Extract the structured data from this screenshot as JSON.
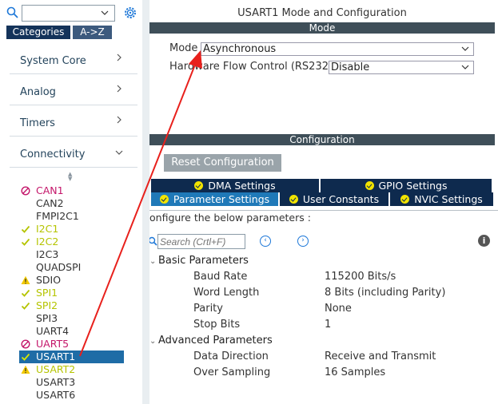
{
  "left": {
    "search": {
      "value": ""
    },
    "tabs": {
      "categories": "Categories",
      "az": "A->Z"
    },
    "categories": [
      {
        "label": "System Core"
      },
      {
        "label": "Analog"
      },
      {
        "label": "Timers"
      },
      {
        "label": "Connectivity"
      }
    ],
    "peripherals": [
      {
        "name": "CAN1",
        "status": "disabled"
      },
      {
        "name": "CAN2",
        "status": "none"
      },
      {
        "name": "FMPI2C1",
        "status": "none"
      },
      {
        "name": "I2C1",
        "status": "ok"
      },
      {
        "name": "I2C2",
        "status": "ok"
      },
      {
        "name": "I2C3",
        "status": "none"
      },
      {
        "name": "QUADSPI",
        "status": "none"
      },
      {
        "name": "SDIO",
        "status": "warning"
      },
      {
        "name": "SPI1",
        "status": "ok"
      },
      {
        "name": "SPI2",
        "status": "ok"
      },
      {
        "name": "SPI3",
        "status": "none"
      },
      {
        "name": "UART4",
        "status": "none"
      },
      {
        "name": "UART5",
        "status": "disabled"
      },
      {
        "name": "USART1",
        "status": "ok-selected"
      },
      {
        "name": "USART2",
        "status": "warning"
      },
      {
        "name": "USART3",
        "status": "none"
      },
      {
        "name": "USART6",
        "status": "none"
      }
    ]
  },
  "right": {
    "title": "USART1 Mode and Configuration",
    "mode_bar": "Mode",
    "mode_label": "Mode",
    "mode_value": "Asynchronous",
    "flow_label": "Hardware Flow Control (RS232)",
    "flow_value": "Disable",
    "config_bar": "Configuration",
    "reset_label": "Reset Configuration",
    "tabs": {
      "dma": "DMA Settings",
      "gpio": "GPIO Settings",
      "params": "Parameter Settings",
      "user": "User Constants",
      "nvic": "NVIC Settings"
    },
    "hint": "onfigure the below parameters :",
    "param_search_placeholder": "Search (Crtl+F)",
    "groups": {
      "basic": "Basic Parameters",
      "advanced": "Advanced Parameters"
    },
    "params": [
      {
        "name": "Baud Rate",
        "value": "115200 Bits/s"
      },
      {
        "name": "Word Length",
        "value": "8 Bits (including Parity)"
      },
      {
        "name": "Parity",
        "value": "None"
      },
      {
        "name": "Stop Bits",
        "value": "1"
      },
      {
        "name": "Data Direction",
        "value": "Receive and Transmit"
      },
      {
        "name": "Over Sampling",
        "value": "16 Samples"
      }
    ]
  },
  "colors": {
    "tab_dark": "#0e2a4e",
    "tab_active": "#1f79b8",
    "selected_row": "#1e6ca6",
    "annotation_arrow": "#e8201c",
    "status_ok": "#b5c400",
    "status_disabled": "#c4166a",
    "status_warning": "#f2c900"
  }
}
